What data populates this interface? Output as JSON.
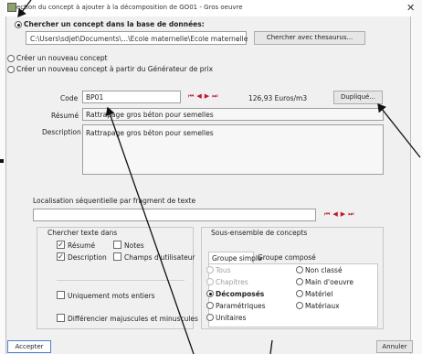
{
  "window": {
    "title": "ection du concept à ajouter à la décomposition de GO01 - Gros oeuvre",
    "close_glyph": "✕"
  },
  "source": {
    "option_db": "Chercher un concept dans la base de données:",
    "path": "C:\\Users\\sdjet\\Documents\\...\\Ecole maternelle\\Ecole maternelle",
    "thesaurus_button": "Chercher avec thesaurus...",
    "option_new": "Créer un nouveau concept",
    "option_new_gen": "Créer un nouveau concept à partir du Générateur de prix"
  },
  "concept": {
    "code_label": "Code",
    "code_value": "BP01",
    "price": "126,93 Euros/m3",
    "duplicate_button": "Dupliqué...",
    "summary_label": "Résumé",
    "summary_value": "Rattrapage gros béton pour semelles",
    "description_label": "Description",
    "description_value": "Rattrapage gros béton pour semelles"
  },
  "nav_glyphs": {
    "first": "⏮",
    "prev": "◀",
    "next": "▶",
    "last": "⏭"
  },
  "localisation": {
    "label": "Localisation séquentielle par fragment de texte"
  },
  "search_in": {
    "title": "Chercher texte dans",
    "resume": "Résumé",
    "notes": "Notes",
    "description": "Description",
    "champs": "Champs d'utilisateur",
    "whole_words": "Uniquement mots entiers",
    "case": "Différencier majuscules et minuscules",
    "check_glyph": "✓"
  },
  "subset": {
    "title": "Sous-ensemble de concepts",
    "tab_simple": "Groupe simple",
    "tab_compose": "Groupe composé",
    "tous": "Tous",
    "chapitres": "Chapitres",
    "decomposes": "Décomposés",
    "parametriques": "Paramétriques",
    "unitaires": "Unitaires",
    "non_classe": "Non classé",
    "main_oeuvre": "Main d'oeuvre",
    "materiel": "Matériel",
    "materiaux": "Matériaux"
  },
  "footer": {
    "accept": "Accepter",
    "cancel": "Annuler"
  },
  "colors": {
    "nav": "#c0192b",
    "frame": "#f0f0f0",
    "annotation": "#111111"
  }
}
